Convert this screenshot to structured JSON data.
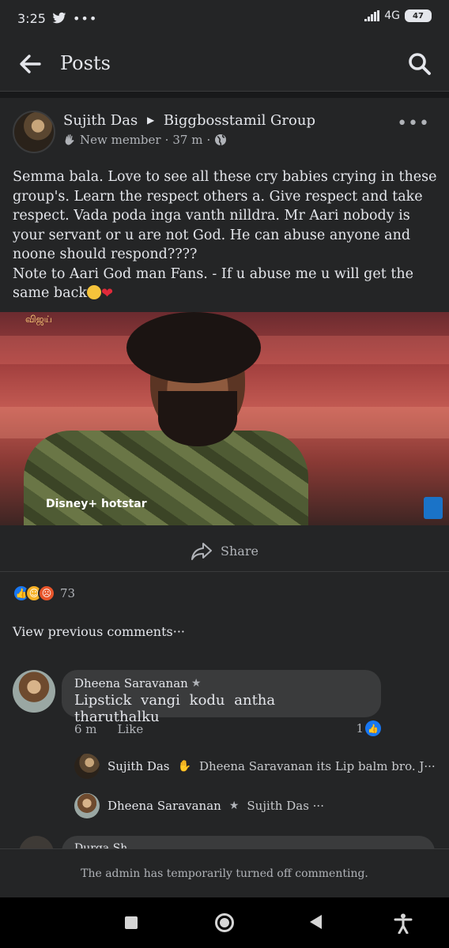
{
  "status_bar": {
    "time": "3:25",
    "dots": "•••",
    "network": "4G",
    "battery": "47"
  },
  "app_bar": {
    "title": "Posts"
  },
  "post": {
    "author": "Sujith Das",
    "group": "Biggbosstamil Group",
    "badge": "New member",
    "time": "37 m",
    "more": "•••",
    "body_lines": [
      "Semma bala. Love to see all these cry babies crying in these group's. Learn the respect others a. Give respect and take respect. Vada poda inga vanth nilldra. Mr Aari nobody is your servant or u are not God. He can abuse anyone and noone should respond????",
      "Note to Aari God man Fans. - If u abuse me u will get the same back"
    ],
    "image_watermark": "விஜய்",
    "image_logo": "Disney+ hotstar",
    "share_label": "Share"
  },
  "reactions": {
    "count": "73"
  },
  "comments": {
    "view_previous": "View previous comments···",
    "first": {
      "author": "Dheena Saravanan",
      "text": "Lipstick vangi kodu antha tharuthalku",
      "time": "6 m",
      "like_label": "Like",
      "like_count": "1"
    },
    "replies": [
      {
        "author": "Sujith Das",
        "text": "Dheena Saravanan its Lip balm bro. J···"
      },
      {
        "author": "Dheena Saravanan",
        "text": "Sujith Das ···"
      }
    ],
    "next_author_partial": "Durga Sh..."
  },
  "footer": {
    "disabled_notice": "The admin has temporarily turned off commenting."
  }
}
